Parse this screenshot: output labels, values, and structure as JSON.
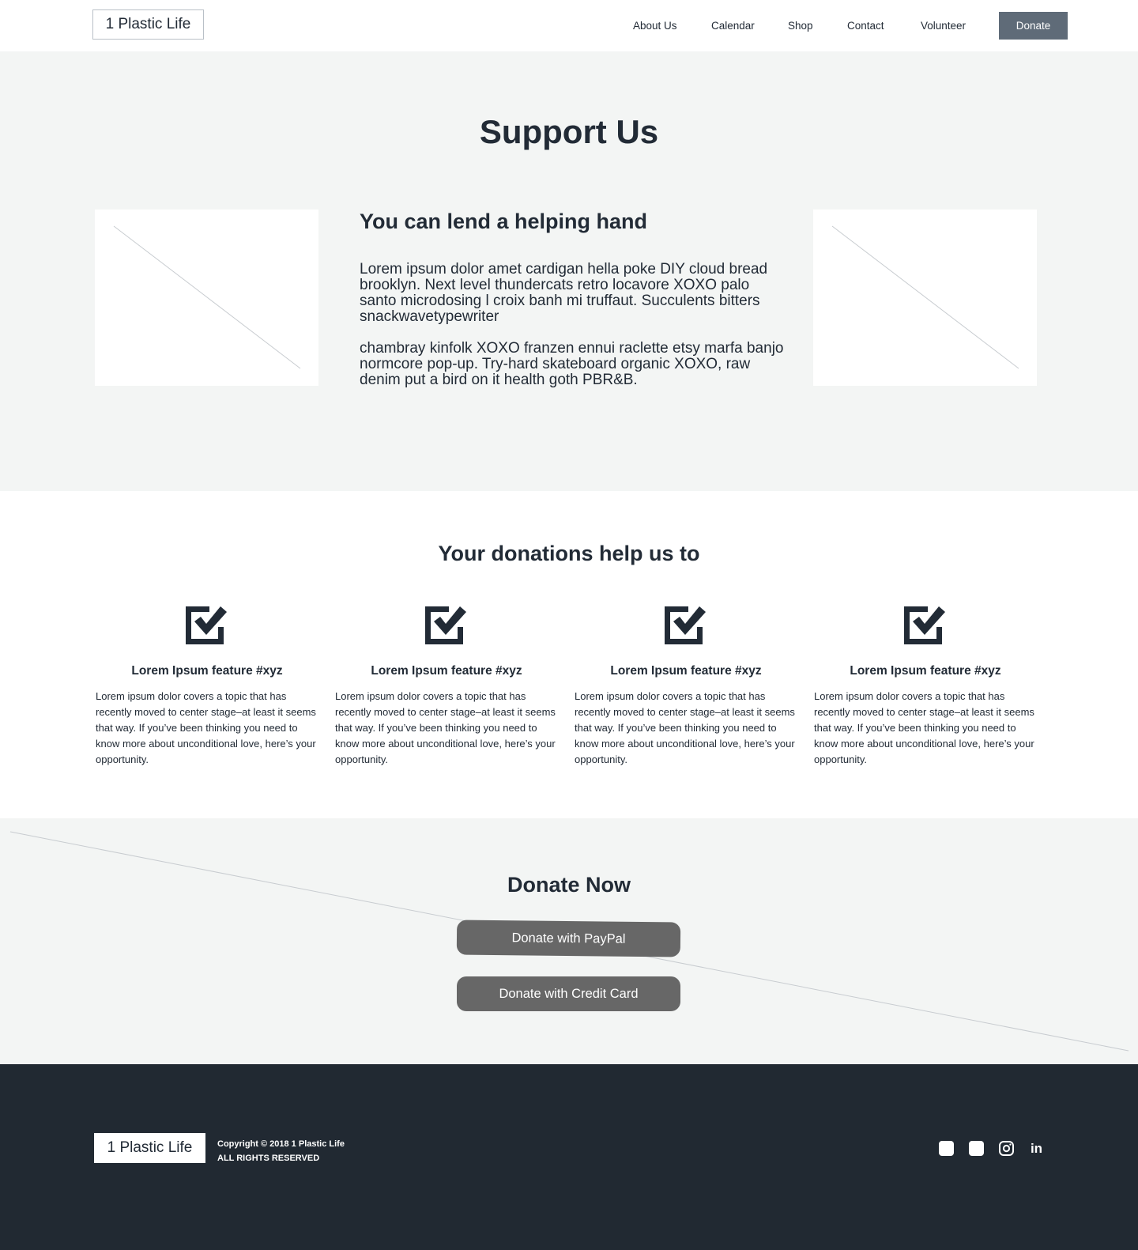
{
  "header": {
    "logo": "1 Plastic Life",
    "nav": [
      "About Us",
      "Calendar",
      "Shop",
      "Contact",
      "Volunteer"
    ],
    "donate_label": "Donate"
  },
  "hero": {
    "title": "Support Us",
    "subtitle": "You can lend a helping hand",
    "paragraphs": [
      "Lorem ipsum dolor amet cardigan hella poke DIY cloud bread brooklyn. Next level thundercats retro locavore XOXO palo santo microdosing l croix banh mi truffaut. Succulents bitters snackwavetypewriter",
      "chambray kinfolk XOXO franzen ennui raclette etsy marfa banjo normcore pop-up. Try-hard skateboard organic XOXO, raw denim put a bird on it health goth PBR&B."
    ]
  },
  "features": {
    "title": "Your donations help us to",
    "items": [
      {
        "icon": "checkbox-checked-icon",
        "title": "Lorem Ipsum feature #xyz",
        "desc": "Lorem ipsum dolor covers a topic that has recently moved to center stage–at least it seems that way. If you’ve been thinking you need to know more about unconditional love, here’s your opportunity."
      },
      {
        "icon": "checkbox-checked-icon",
        "title": "Lorem Ipsum feature #xyz",
        "desc": "Lorem ipsum dolor covers a topic that has recently moved to center stage–at least it seems that way. If you’ve been thinking you need to know more about unconditional love, here’s your opportunity."
      },
      {
        "icon": "checkbox-checked-icon",
        "title": "Lorem Ipsum feature #xyz",
        "desc": "Lorem ipsum dolor covers a topic that has recently moved to center stage–at least it seems that way. If you’ve been thinking you need to know more about unconditional love, here’s your opportunity."
      },
      {
        "icon": "checkbox-checked-icon",
        "title": "Lorem Ipsum feature #xyz",
        "desc": "Lorem ipsum dolor covers a topic that has recently moved to center stage–at least it seems that way. If you’ve been thinking you need to know more about unconditional love, here’s your opportunity."
      }
    ]
  },
  "donate": {
    "title": "Donate Now",
    "paypal_label": "Donate with PayPal",
    "card_label": "Donate with Credit Card"
  },
  "footer": {
    "logo": "1 Plastic Life",
    "copyright": "Copyright © 2018 1 Plastic Life",
    "rights": "ALL RIGHTS RESERVED",
    "social": [
      "social-icon",
      "social-icon",
      "instagram-icon",
      "linkedin-icon"
    ],
    "linkedin_glyph": "in"
  },
  "colors": {
    "text": "#222b36",
    "donate_button": "#5f6b78",
    "section_bg": "#f3f5f4",
    "pay_button": "#676767",
    "footer_bg": "#212932"
  }
}
